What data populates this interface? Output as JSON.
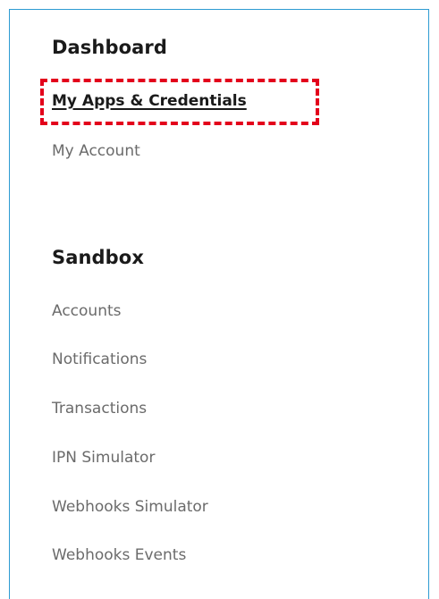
{
  "dashboard": {
    "title": "Dashboard",
    "items": [
      {
        "label": "My Apps & Credentials"
      },
      {
        "label": "My Account"
      }
    ]
  },
  "sandbox": {
    "title": "Sandbox",
    "items": [
      {
        "label": "Accounts"
      },
      {
        "label": "Notifications"
      },
      {
        "label": "Transactions"
      },
      {
        "label": "IPN Simulator"
      },
      {
        "label": "Webhooks Simulator"
      },
      {
        "label": "Webhooks Events"
      }
    ]
  },
  "colors": {
    "border": "#2d9bd2",
    "highlight": "#e3001b",
    "heading": "#1a1a1a",
    "link": "#6b6b6b"
  }
}
